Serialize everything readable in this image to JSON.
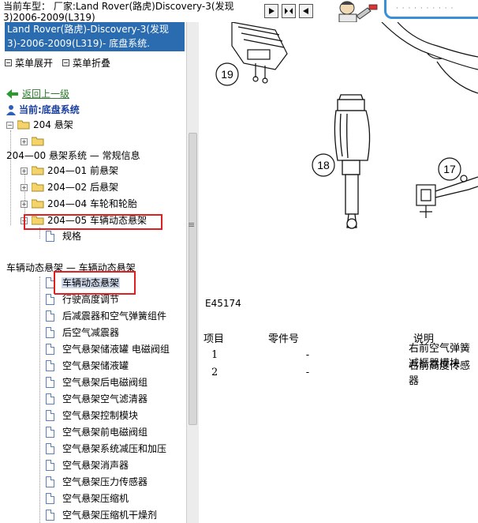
{
  "topbar": {
    "title": "当前车型： 厂家:Land Rover(路虎)Discovery-3(发现3)2006-2009(L319)"
  },
  "left": {
    "car_header": "Land Rover(路虎)-Discovery-3(发现3)-2006-2009(L319)- 底盘系统.",
    "menu_expand": "菜单展开",
    "menu_collapse": "菜单折叠",
    "back_link": "返回上一级",
    "current": "当前:底盘系统",
    "tree": {
      "n204": "204 悬架",
      "n204_00": "204—00 悬架系统 — 常规信息",
      "n204_01": "204—01 前悬架",
      "n204_02": "204—02 后悬架",
      "n204_04": "204—04 车轮和轮胎",
      "n204_05": "204—05 车辆动态悬架",
      "spec": "规格",
      "section_label": "车辆动态悬架 — 车辆动态悬架",
      "docs": [
        "车辆动态悬架",
        "行驶高度调节",
        "后减震器和空气弹簧组件",
        "后空气减震器",
        "空气悬架储液罐 电磁阀组",
        "空气悬架储液罐",
        "空气悬架后电磁阀组",
        "空气悬架空气滤清器",
        "空气悬架控制模块",
        "空气悬架前电磁阀组",
        "空气悬架系统减压和加压",
        "空气悬架消声器",
        "空气悬架压力传感器",
        "空气悬架压缩机",
        "空气悬架压缩机干燥剂"
      ]
    }
  },
  "content": {
    "callouts": [
      "19",
      "18",
      "17"
    ],
    "figure_code": "E45174",
    "table": {
      "headers": [
        "项目",
        "零件号",
        "说明"
      ],
      "rows": [
        [
          "1",
          "-",
          "右前空气弹簧减振器模块"
        ],
        [
          "2",
          "-",
          "右前高度传感器"
        ]
      ]
    }
  }
}
